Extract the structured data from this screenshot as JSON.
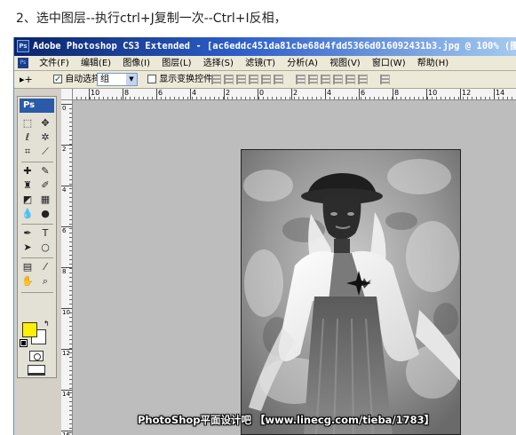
{
  "caption": "2、选中图层--执行ctrl+J复制一次--Ctrl+I反相，",
  "titlebar": {
    "title": "Adobe Photoshop CS3 Extended - [ac6eddc451da81cbe68d4fdd5366d016092431b3.jpg @ 100% (图层 1 副本, RGB/",
    "app_icon": "Ps"
  },
  "menubar": {
    "items": [
      "文件(F)",
      "编辑(E)",
      "图像(I)",
      "图层(L)",
      "选择(S)",
      "滤镜(T)",
      "分析(A)",
      "视图(V)",
      "窗口(W)",
      "帮助(H)"
    ]
  },
  "options": {
    "tool_preset": "▸+",
    "auto_select_label": "自动选择:",
    "auto_select_value": "组",
    "show_transform_label": "显示变换控件"
  },
  "rulers": {
    "h_ticks": [
      "10",
      "8",
      "6",
      "4",
      "2",
      "0",
      "2",
      "4",
      "6",
      "8",
      "10",
      "12",
      "14"
    ],
    "v_ticks": [
      "0",
      "2",
      "4",
      "6",
      "8",
      "10",
      "12",
      "14",
      "16"
    ]
  },
  "toolbox": {
    "logo": "Ps"
  },
  "colors": {
    "foreground": "#ffef00",
    "background": "#ffffff",
    "title_gradient_start": "#0a246a",
    "workspace": "#bdbdbd"
  },
  "watermark": "PhotoShop平面设计吧 【www.linecg.com/tieba/1783】"
}
